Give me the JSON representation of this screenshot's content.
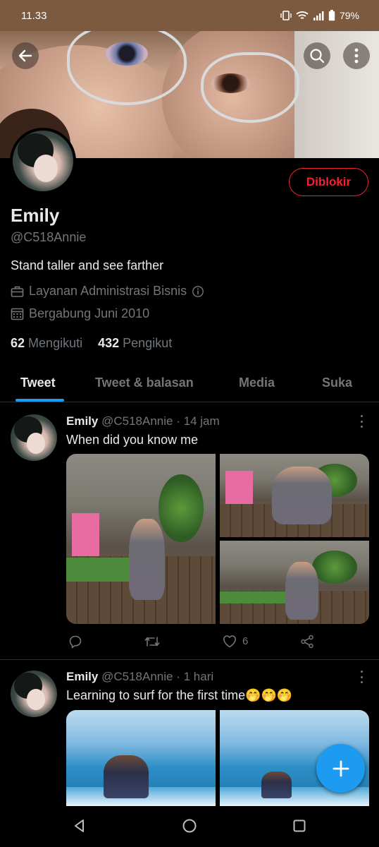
{
  "status_bar": {
    "time": "11.33",
    "battery": "79%"
  },
  "profile": {
    "name": "Emily",
    "handle": "@C518Annie",
    "bio": "Stand taller and see farther",
    "category": "Layanan Administrasi Bisnis",
    "joined": "Bergabung Juni 2010",
    "following_count": "62",
    "following_label": "Mengikuti",
    "followers_count": "432",
    "followers_label": "Pengikut",
    "blocked_label": "Diblokir"
  },
  "tabs": [
    {
      "label": "Tweet",
      "active": true
    },
    {
      "label": "Tweet & balasan",
      "active": false
    },
    {
      "label": "Media",
      "active": false
    },
    {
      "label": "Suka",
      "active": false
    }
  ],
  "tweets": [
    {
      "name": "Emily",
      "handle": "@C518Annie",
      "time": "14 jam",
      "text": "When did you know me",
      "likes": "6"
    },
    {
      "name": "Emily",
      "handle": "@C518Annie",
      "time": "1 hari",
      "text": "Learning to surf for the first time🤭🤭🤭"
    }
  ],
  "colors": {
    "accent": "#1d9bf0",
    "blocked": "#f4212e",
    "muted": "#71767b",
    "background": "#000000"
  },
  "icons": [
    "back-arrow-icon",
    "search-icon",
    "more-vertical-icon",
    "briefcase-icon",
    "info-icon",
    "calendar-icon",
    "reply-icon",
    "retweet-icon",
    "like-icon",
    "share-icon",
    "plus-icon",
    "nav-back-icon",
    "nav-home-icon",
    "nav-recents-icon"
  ]
}
